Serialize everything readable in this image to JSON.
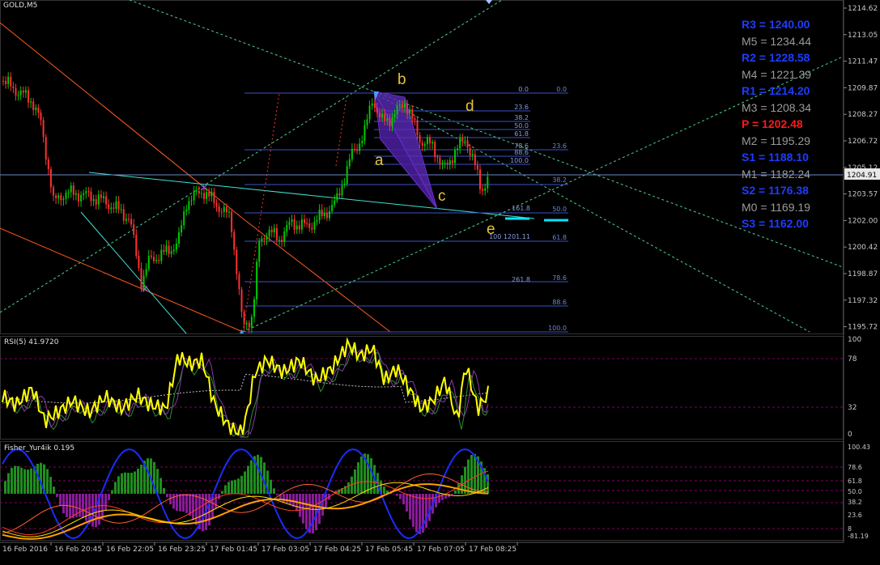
{
  "window": {
    "symbol_title": "GOLD,M5"
  },
  "price_axis": {
    "labels": [
      "1214.62",
      "1213.05",
      "1211.47",
      "1209.87",
      "1208.27",
      "1206.72",
      "1205.12",
      "1203.57",
      "1202.00",
      "1200.42",
      "1198.87",
      "1197.32",
      "1195.72"
    ],
    "current_price": "1204.91"
  },
  "rsi_pane": {
    "title": "RSI(5) 41.9720",
    "levels": [
      "100",
      "78",
      "32",
      "0"
    ]
  },
  "fisher_pane": {
    "title": "Fisher_Yur4ik 0.195",
    "levels": [
      "100.43",
      "78.6",
      "61.8",
      "50.0",
      "38.2",
      "23.6",
      "8",
      "-81.19"
    ]
  },
  "time_axis": {
    "labels": [
      "16 Feb 2016",
      "16 Feb 20:45",
      "16 Feb 22:05",
      "16 Feb 23:25",
      "17 Feb 01:45",
      "17 Feb 03:05",
      "17 Feb 04:25",
      "17 Feb 05:45",
      "17 Feb 07:05",
      "17 Feb 08:25"
    ]
  },
  "pivots": [
    {
      "label": "R3 = 1240.00",
      "color": "#1e3cff"
    },
    {
      "label": "M5 = 1234.44",
      "color": "#9a9a9a"
    },
    {
      "label": "R2 = 1228.58",
      "color": "#1e3cff"
    },
    {
      "label": "M4 = 1221.39",
      "color": "#9a9a9a"
    },
    {
      "label": "R1 = 1214.20",
      "color": "#1e3cff"
    },
    {
      "label": "M3 = 1208.34",
      "color": "#9a9a9a"
    },
    {
      "label": "P   = 1202.48",
      "color": "#ff1a1a"
    },
    {
      "label": "M2 = 1195.29",
      "color": "#9a9a9a"
    },
    {
      "label": "S1 = 1188.10",
      "color": "#1e3cff"
    },
    {
      "label": "M1 = 1182.24",
      "color": "#9a9a9a"
    },
    {
      "label": "S2 = 1176.38",
      "color": "#1e3cff"
    },
    {
      "label": "M0 = 1169.19",
      "color": "#9a9a9a"
    },
    {
      "label": "S3 = 1162.00",
      "color": "#1e3cff"
    }
  ],
  "wave_labels": {
    "a": "a",
    "b": "b",
    "c": "c",
    "d": "d",
    "e": "e"
  },
  "fibo_set_1": [
    "0.0",
    "23.6",
    "38.2",
    "50.0",
    "61.8",
    "78.6",
    "88.6",
    "100.0"
  ],
  "fibo_set_2": [
    "0.0",
    "23.6",
    "38.2",
    "50.0",
    "61.8",
    "78.6",
    "88.6",
    "100.0"
  ],
  "fibo_ext": [
    "161.8",
    "261.8"
  ],
  "fibo_ext_price": "100 1201.11",
  "colors": {
    "bull": "#00c800",
    "bear": "#ff3030",
    "grid": "#1a1a1a",
    "fibo": "#3a52c8",
    "trend_green": "#3cb371",
    "rsi_line": "#ffff00",
    "pattern": "#6a2cc7",
    "label_yellow": "#e6c235"
  }
}
